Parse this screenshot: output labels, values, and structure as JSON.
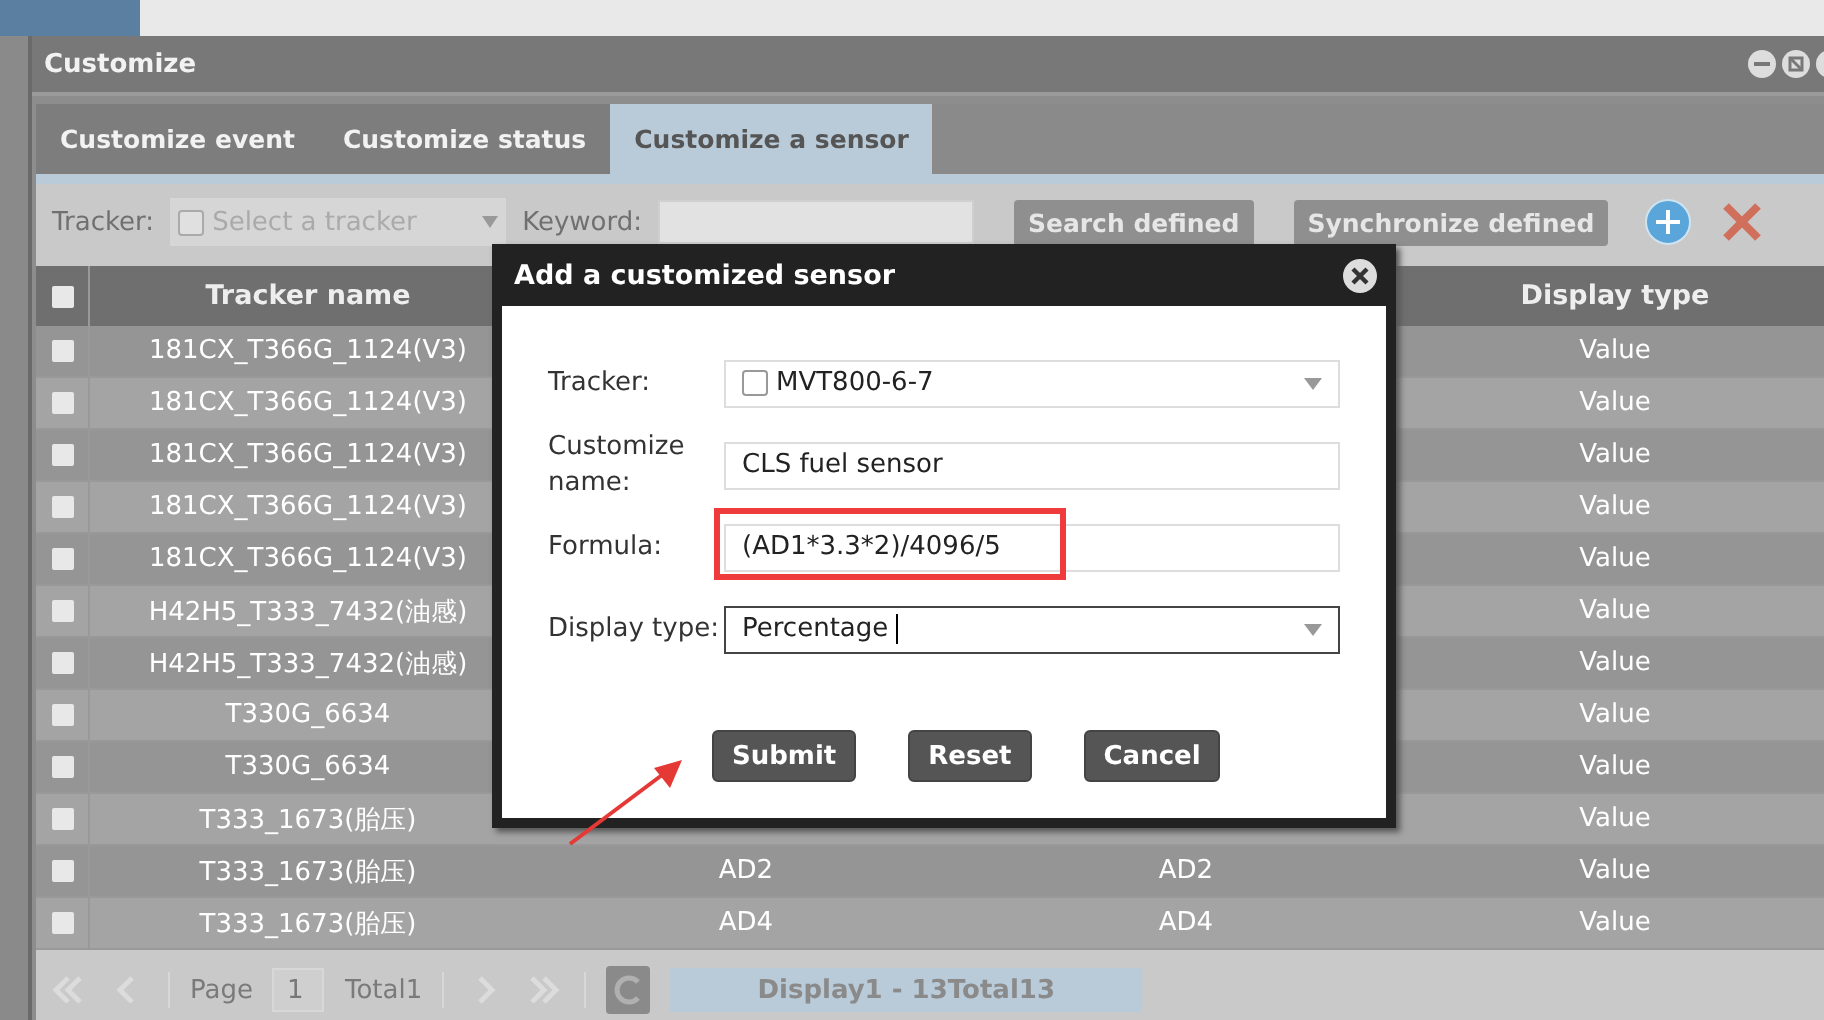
{
  "window": {
    "title": "Customize"
  },
  "tabs": [
    {
      "label": "Customize event",
      "selected": false
    },
    {
      "label": "Customize status",
      "selected": false
    },
    {
      "label": "Customize a sensor",
      "selected": true
    }
  ],
  "toolbar": {
    "tracker_label": "Tracker:",
    "tracker_placeholder": "Select a tracker",
    "keyword_label": "Keyword:",
    "buttons": [
      "Search defined",
      "Synchronize defined"
    ]
  },
  "table": {
    "all_checked": false,
    "columns": [
      "Tracker name",
      "Display type"
    ],
    "rows": [
      {
        "checked": false,
        "tracker": "181CX_T366G_1124(V3)",
        "display": "Value"
      },
      {
        "checked": false,
        "tracker": "181CX_T366G_1124(V3)",
        "display": "Value"
      },
      {
        "checked": false,
        "tracker": "181CX_T366G_1124(V3)",
        "display": "Value"
      },
      {
        "checked": false,
        "tracker": "181CX_T366G_1124(V3)",
        "display": "Value"
      },
      {
        "checked": false,
        "tracker": "181CX_T366G_1124(V3)",
        "display": "Value"
      },
      {
        "checked": false,
        "tracker": "H42H5_T333_7432(油感)",
        "display": "Value"
      },
      {
        "checked": false,
        "tracker": "H42H5_T333_7432(油感)",
        "display": "Value"
      },
      {
        "checked": false,
        "tracker": "T330G_6634",
        "display": "Value"
      },
      {
        "checked": false,
        "tracker": "T330G_6634",
        "display": "Value"
      },
      {
        "checked": false,
        "tracker": "T333_1673(胎压)",
        "display": "Value"
      },
      {
        "checked": false,
        "tracker": "T333_1673(胎压)",
        "column_2": "AD2",
        "column_3": "AD2",
        "display": "Value"
      },
      {
        "checked": false,
        "tracker": "T333_1673(胎压)",
        "column_2": "AD4",
        "column_3": "AD4",
        "display": "Value"
      }
    ]
  },
  "pager": {
    "page_label": "Page",
    "page": "1",
    "total": "Total1",
    "display": "Display1 - 13Total13"
  },
  "dialog": {
    "title": "Add a customized sensor",
    "fields": [
      {
        "kind": "checkselect",
        "label": "Tracker:",
        "value": "MVT800-6-7",
        "checked": false,
        "highlighted": false,
        "focused": false
      },
      {
        "kind": "text",
        "label": "Customize name:",
        "value": "CLS fuel sensor",
        "highlighted": false,
        "focused": false
      },
      {
        "kind": "text",
        "label": "Formula:",
        "value": "(AD1*3.3*2)/4096/5",
        "highlighted": true,
        "focused": false
      },
      {
        "kind": "select",
        "label": "Display type:",
        "value": "Percentage",
        "highlighted": false,
        "focused": true
      }
    ],
    "buttons": [
      "Submit",
      "Reset",
      "Cancel"
    ]
  }
}
